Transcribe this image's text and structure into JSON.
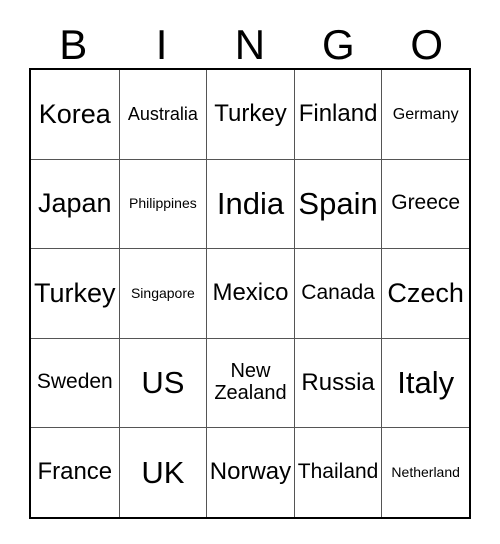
{
  "card": {
    "title": "BINGO",
    "headers": [
      "B",
      "I",
      "N",
      "G",
      "O"
    ],
    "colors": {
      "background": "#ffffff",
      "text": "#000000",
      "outer_border": "#000000",
      "inner_border": "#555555"
    },
    "rows": [
      [
        {
          "label": "Korea",
          "size": "xl"
        },
        {
          "label": "Australia",
          "size": "s"
        },
        {
          "label": "Turkey",
          "size": "l"
        },
        {
          "label": "Finland",
          "size": "l"
        },
        {
          "label": "Germany",
          "size": "xs"
        }
      ],
      [
        {
          "label": "Japan",
          "size": "xl"
        },
        {
          "label": "Philippines",
          "size": "xxs"
        },
        {
          "label": "India",
          "size": "xxl"
        },
        {
          "label": "Spain",
          "size": "xxl"
        },
        {
          "label": "Greece",
          "size": "m"
        }
      ],
      [
        {
          "label": "Turkey",
          "size": "xl"
        },
        {
          "label": "Singapore",
          "size": "xxs"
        },
        {
          "label": "Mexico",
          "size": "l"
        },
        {
          "label": "Canada",
          "size": "m"
        },
        {
          "label": "Czech",
          "size": "xl"
        }
      ],
      [
        {
          "label": "Sweden",
          "size": "m"
        },
        {
          "label": "US",
          "size": "xxl"
        },
        {
          "label": "New\nZealand",
          "size": "two"
        },
        {
          "label": "Russia",
          "size": "l"
        },
        {
          "label": "Italy",
          "size": "xxl"
        }
      ],
      [
        {
          "label": "France",
          "size": "l"
        },
        {
          "label": "UK",
          "size": "xxl"
        },
        {
          "label": "Norway",
          "size": "l"
        },
        {
          "label": "Thailand",
          "size": "m"
        },
        {
          "label": "Netherland",
          "size": "xxs"
        }
      ]
    ]
  }
}
